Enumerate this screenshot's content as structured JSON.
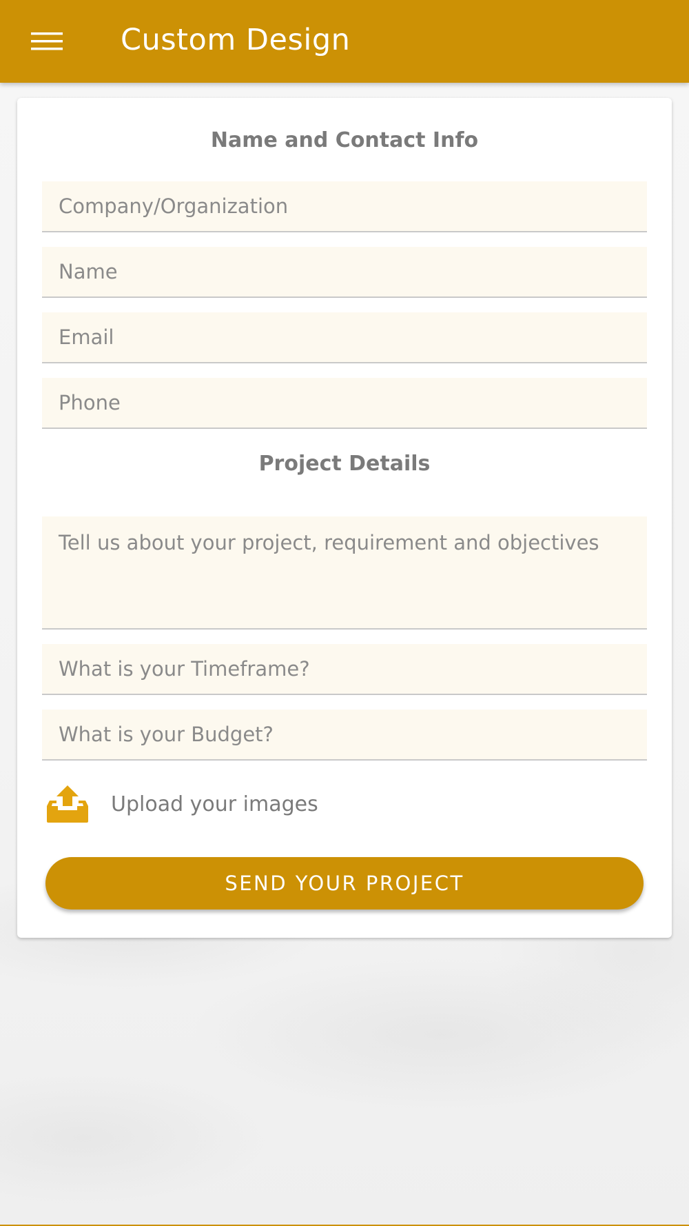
{
  "appbar": {
    "menu_icon": "hamburger-menu-icon",
    "title": "Custom Design",
    "color": "#cc9105"
  },
  "contact_section": {
    "title": "Name and Contact Info",
    "company_placeholder": "Company/Organization",
    "name_placeholder": "Name",
    "email_placeholder": "Email",
    "phone_placeholder": "Phone"
  },
  "project_section": {
    "title": "Project Details",
    "description_placeholder": "Tell us about your project, requirement and objectives",
    "timeframe_placeholder": "What is your Timeframe?",
    "budget_placeholder": "What is your Budget?"
  },
  "upload": {
    "icon": "upload-tray-icon",
    "label": "Upload your images"
  },
  "submit": {
    "label": "SEND YOUR PROJECT"
  },
  "colors": {
    "accent": "#cc9105",
    "field_background": "#fdf9ef",
    "text_muted": "#7a7a7a"
  }
}
